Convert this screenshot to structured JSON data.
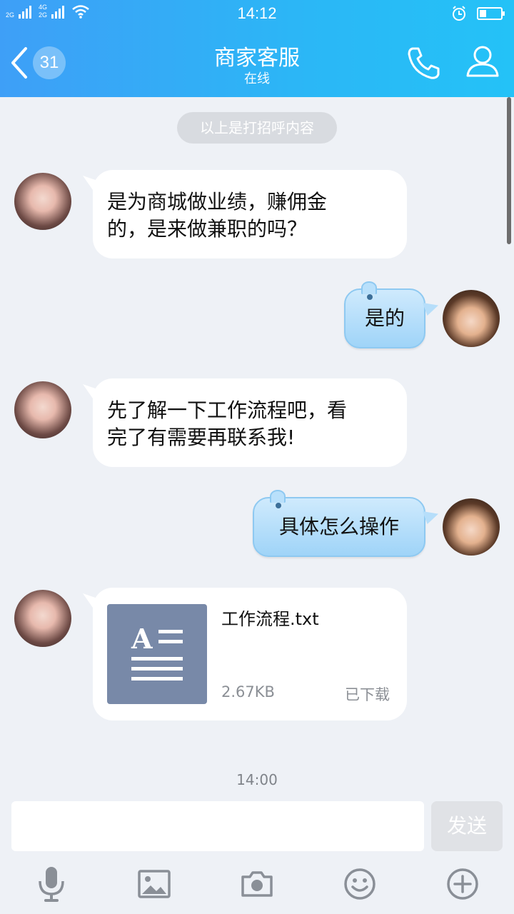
{
  "status_bar": {
    "time": "14:12",
    "network_1": "2G",
    "network_2_top": "4G",
    "network_2_bottom": "2G",
    "icons": [
      "signal-icon",
      "wifi-icon",
      "alarm-icon",
      "battery-icon"
    ]
  },
  "header": {
    "back_count": "31",
    "title": "商家客服",
    "subtitle": "在线"
  },
  "chat": {
    "notice": "以上是打招呼内容",
    "messages": [
      {
        "side": "left",
        "lines": [
          "是为商城做业绩，赚佣金",
          "的，是来做兼职的吗？"
        ]
      },
      {
        "side": "right",
        "text": "是的"
      },
      {
        "side": "left",
        "lines": [
          "先了解一下工作流程吧，看",
          "完了有需要再联系我!"
        ]
      },
      {
        "side": "right",
        "text": "具体怎么操作"
      }
    ],
    "file": {
      "name": "工作流程.txt",
      "size": "2.67KB",
      "status": "已下载"
    },
    "timestamp": "14:00"
  },
  "input": {
    "placeholder": "",
    "send_label": "发送"
  },
  "toolbar": [
    "microphone-icon",
    "image-icon",
    "camera-icon",
    "emoji-icon",
    "plus-icon"
  ],
  "colors": {
    "header_start": "#3e9ff7",
    "header_end": "#24c2f7",
    "background": "#eef1f6",
    "right_bubble": "#b6defa",
    "file_icon": "#7889a8"
  }
}
